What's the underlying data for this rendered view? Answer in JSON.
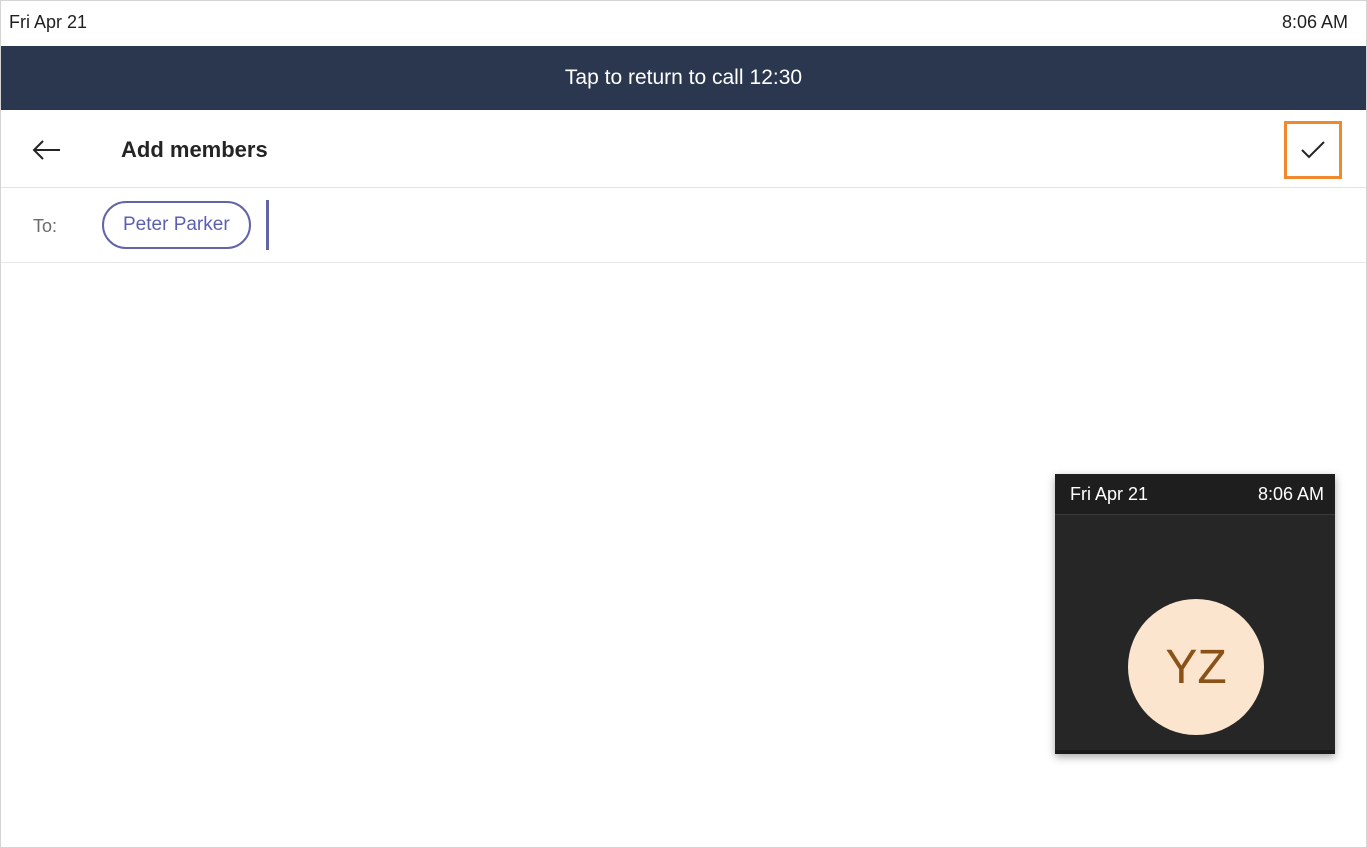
{
  "status_bar": {
    "date": "Fri Apr 21",
    "time": "8:06 AM"
  },
  "call_banner": {
    "text": "Tap to return to call",
    "duration": "12:30"
  },
  "header": {
    "title": "Add members",
    "back_icon": "arrow-left-icon",
    "confirm_icon": "checkmark-icon",
    "confirm_highlight_color": "#f0892e"
  },
  "recipients": {
    "label": "To:",
    "chips": [
      "Peter Parker"
    ],
    "input_value": "",
    "accent_color": "#6264a7"
  },
  "mini_preview": {
    "date": "Fri Apr 21",
    "time": "8:06 AM",
    "avatar_initials": "YZ",
    "avatar_bg": "#fbe5cf",
    "avatar_text_color": "#8b5218"
  },
  "colors": {
    "banner_bg": "#2a374f",
    "preview_bg": "#262626"
  }
}
